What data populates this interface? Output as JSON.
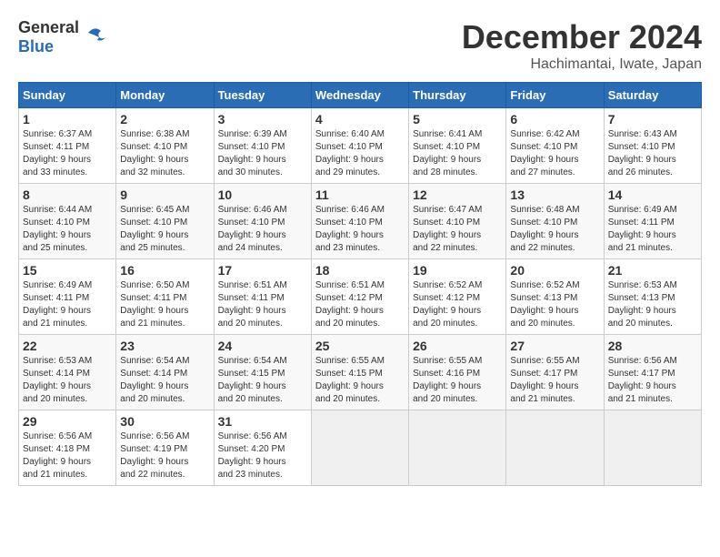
{
  "header": {
    "logo_general": "General",
    "logo_blue": "Blue",
    "month_title": "December 2024",
    "location": "Hachimantai, Iwate, Japan"
  },
  "days_of_week": [
    "Sunday",
    "Monday",
    "Tuesday",
    "Wednesday",
    "Thursday",
    "Friday",
    "Saturday"
  ],
  "weeks": [
    [
      {
        "day": "1",
        "sunrise": "6:37 AM",
        "sunset": "4:11 PM",
        "daylight": "9 hours and 33 minutes."
      },
      {
        "day": "2",
        "sunrise": "6:38 AM",
        "sunset": "4:10 PM",
        "daylight": "9 hours and 32 minutes."
      },
      {
        "day": "3",
        "sunrise": "6:39 AM",
        "sunset": "4:10 PM",
        "daylight": "9 hours and 30 minutes."
      },
      {
        "day": "4",
        "sunrise": "6:40 AM",
        "sunset": "4:10 PM",
        "daylight": "9 hours and 29 minutes."
      },
      {
        "day": "5",
        "sunrise": "6:41 AM",
        "sunset": "4:10 PM",
        "daylight": "9 hours and 28 minutes."
      },
      {
        "day": "6",
        "sunrise": "6:42 AM",
        "sunset": "4:10 PM",
        "daylight": "9 hours and 27 minutes."
      },
      {
        "day": "7",
        "sunrise": "6:43 AM",
        "sunset": "4:10 PM",
        "daylight": "9 hours and 26 minutes."
      }
    ],
    [
      {
        "day": "8",
        "sunrise": "6:44 AM",
        "sunset": "4:10 PM",
        "daylight": "9 hours and 25 minutes."
      },
      {
        "day": "9",
        "sunrise": "6:45 AM",
        "sunset": "4:10 PM",
        "daylight": "9 hours and 25 minutes."
      },
      {
        "day": "10",
        "sunrise": "6:46 AM",
        "sunset": "4:10 PM",
        "daylight": "9 hours and 24 minutes."
      },
      {
        "day": "11",
        "sunrise": "6:46 AM",
        "sunset": "4:10 PM",
        "daylight": "9 hours and 23 minutes."
      },
      {
        "day": "12",
        "sunrise": "6:47 AM",
        "sunset": "4:10 PM",
        "daylight": "9 hours and 22 minutes."
      },
      {
        "day": "13",
        "sunrise": "6:48 AM",
        "sunset": "4:10 PM",
        "daylight": "9 hours and 22 minutes."
      },
      {
        "day": "14",
        "sunrise": "6:49 AM",
        "sunset": "4:11 PM",
        "daylight": "9 hours and 21 minutes."
      }
    ],
    [
      {
        "day": "15",
        "sunrise": "6:49 AM",
        "sunset": "4:11 PM",
        "daylight": "9 hours and 21 minutes."
      },
      {
        "day": "16",
        "sunrise": "6:50 AM",
        "sunset": "4:11 PM",
        "daylight": "9 hours and 21 minutes."
      },
      {
        "day": "17",
        "sunrise": "6:51 AM",
        "sunset": "4:11 PM",
        "daylight": "9 hours and 20 minutes."
      },
      {
        "day": "18",
        "sunrise": "6:51 AM",
        "sunset": "4:12 PM",
        "daylight": "9 hours and 20 minutes."
      },
      {
        "day": "19",
        "sunrise": "6:52 AM",
        "sunset": "4:12 PM",
        "daylight": "9 hours and 20 minutes."
      },
      {
        "day": "20",
        "sunrise": "6:52 AM",
        "sunset": "4:13 PM",
        "daylight": "9 hours and 20 minutes."
      },
      {
        "day": "21",
        "sunrise": "6:53 AM",
        "sunset": "4:13 PM",
        "daylight": "9 hours and 20 minutes."
      }
    ],
    [
      {
        "day": "22",
        "sunrise": "6:53 AM",
        "sunset": "4:14 PM",
        "daylight": "9 hours and 20 minutes."
      },
      {
        "day": "23",
        "sunrise": "6:54 AM",
        "sunset": "4:14 PM",
        "daylight": "9 hours and 20 minutes."
      },
      {
        "day": "24",
        "sunrise": "6:54 AM",
        "sunset": "4:15 PM",
        "daylight": "9 hours and 20 minutes."
      },
      {
        "day": "25",
        "sunrise": "6:55 AM",
        "sunset": "4:15 PM",
        "daylight": "9 hours and 20 minutes."
      },
      {
        "day": "26",
        "sunrise": "6:55 AM",
        "sunset": "4:16 PM",
        "daylight": "9 hours and 20 minutes."
      },
      {
        "day": "27",
        "sunrise": "6:55 AM",
        "sunset": "4:17 PM",
        "daylight": "9 hours and 21 minutes."
      },
      {
        "day": "28",
        "sunrise": "6:56 AM",
        "sunset": "4:17 PM",
        "daylight": "9 hours and 21 minutes."
      }
    ],
    [
      {
        "day": "29",
        "sunrise": "6:56 AM",
        "sunset": "4:18 PM",
        "daylight": "9 hours and 21 minutes."
      },
      {
        "day": "30",
        "sunrise": "6:56 AM",
        "sunset": "4:19 PM",
        "daylight": "9 hours and 22 minutes."
      },
      {
        "day": "31",
        "sunrise": "6:56 AM",
        "sunset": "4:20 PM",
        "daylight": "9 hours and 23 minutes."
      },
      null,
      null,
      null,
      null
    ]
  ]
}
